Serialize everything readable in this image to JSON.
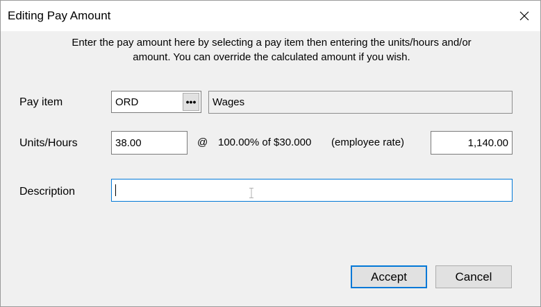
{
  "window": {
    "title": "Editing Pay Amount"
  },
  "instructions": {
    "line1": "Enter the pay amount here by selecting a pay item then entering the units/hours and/or",
    "line2": "amount. You can override the calculated amount if you wish."
  },
  "pay_item": {
    "label": "Pay item",
    "code": "ORD",
    "lookup_button": "•••",
    "name": "Wages"
  },
  "units": {
    "label": "Units/Hours",
    "value": "38.00",
    "at_symbol": "@",
    "rate_text": "100.00% of $30.000",
    "rate_note": "(employee rate)",
    "amount": "1,140.00"
  },
  "description": {
    "label": "Description",
    "value": ""
  },
  "buttons": {
    "accept": "Accept",
    "cancel": "Cancel"
  },
  "colors": {
    "focus_border": "#0078d7",
    "dialog_bg": "#f0f0f0"
  },
  "icons": {
    "close": "close-icon",
    "text_cursor": "i-beam-cursor-icon"
  }
}
